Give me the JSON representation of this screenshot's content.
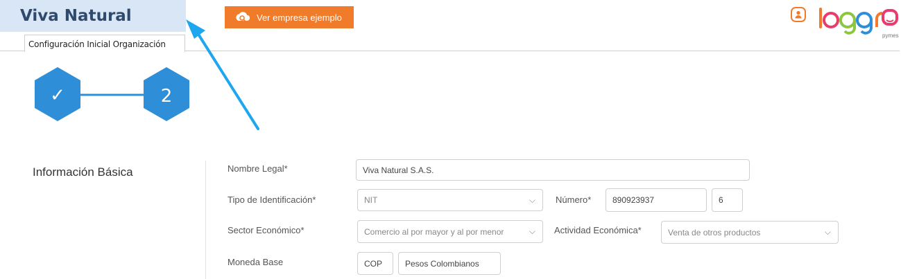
{
  "header": {
    "company_name": "Viva Natural",
    "demo_button_label": "Ver empresa ejemplo",
    "brand": {
      "logo_text": "loggro",
      "logo_sub": "pymes",
      "accent_color": "#ef7b2b"
    }
  },
  "tabs": [
    {
      "label": "Configuración Inicial Organización",
      "active": true
    }
  ],
  "stepper": {
    "step1_symbol": "✓",
    "step2_label": "2",
    "color": "#2e8fd8"
  },
  "form": {
    "section_title": "Información Básica",
    "nombre_legal": {
      "label": "Nombre Legal*",
      "value": "Viva Natural S.A.S."
    },
    "tipo_identificacion": {
      "label": "Tipo de Identificación*",
      "value": "NIT"
    },
    "numero": {
      "label": "Número*",
      "value": "890923937",
      "dv": "6"
    },
    "sector_economico": {
      "label": "Sector Económico*",
      "value": "Comercio al por mayor y al por menor"
    },
    "actividad_economica": {
      "label": "Actividad Económica*",
      "value": "Venta de otros productos"
    },
    "moneda_base": {
      "label": "Moneda Base",
      "code": "COP",
      "name": "Pesos Colombianos"
    }
  }
}
